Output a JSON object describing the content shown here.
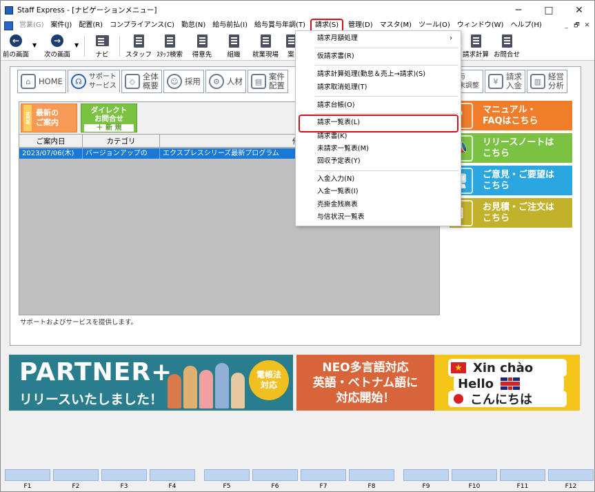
{
  "window": {
    "title": "Staff Express - [ナビゲーションメニュー]",
    "minimize": "─",
    "maximize": "□",
    "close": "✕"
  },
  "menubar": {
    "items": [
      {
        "label": "営業(G)",
        "disabled": true
      },
      {
        "label": "案件(J)"
      },
      {
        "label": "配置(R)"
      },
      {
        "label": "コンプライアンス(C)"
      },
      {
        "label": "勤怠(N)"
      },
      {
        "label": "給与前払(I)"
      },
      {
        "label": "給与賞与年調(T)"
      },
      {
        "label": "請求(S)",
        "active": true
      },
      {
        "label": "管理(D)"
      },
      {
        "label": "マスタ(M)"
      },
      {
        "label": "ツール(O)"
      },
      {
        "label": "ウィンドウ(W)"
      },
      {
        "label": "ヘルプ(H)"
      }
    ],
    "mdi": [
      "_",
      "🗗",
      "✕"
    ]
  },
  "toolbar": {
    "items": [
      {
        "name": "prev-screen-button",
        "label": "前の画面"
      },
      {
        "name": "next-screen-button",
        "label": "次の画面"
      },
      {
        "name": "navi-button",
        "label": "ナビ"
      },
      {
        "name": "staff-button",
        "label": "スタッフ"
      },
      {
        "name": "staff-search-button",
        "label": "ｽﾀｯﾌ検索"
      },
      {
        "name": "client-button",
        "label": "得意先"
      },
      {
        "name": "organization-button",
        "label": "組織"
      },
      {
        "name": "worksite-button",
        "label": "就業現場"
      },
      {
        "name": "case-button",
        "label": "案"
      },
      {
        "name": "billing-calc-button",
        "label": "請求計算"
      },
      {
        "name": "inquiry-button",
        "label": "お問合せ"
      }
    ]
  },
  "tabs": [
    {
      "label": "HOME"
    },
    {
      "label": "サポート\nサービス",
      "active": true
    },
    {
      "label": "全体\n概要"
    },
    {
      "label": "採用"
    },
    {
      "label": "人材"
    },
    {
      "label": "案件\n配置"
    },
    {
      "label": "給与\n年末調整"
    },
    {
      "label": "請求\n入金"
    },
    {
      "label": "経営\n分析"
    }
  ],
  "panel": {
    "news_button": {
      "tag": "NEW",
      "line1": "最新の",
      "line2": "ご案内"
    },
    "direct_button": {
      "line1": "ダイレクト",
      "line2": "お問合せ",
      "new": "＋ 新 規"
    },
    "columns": [
      "ご案内日",
      "カテゴリ",
      "件名"
    ],
    "rows": [
      [
        "2023/07/06(木)",
        "バージョンアップの",
        "エクスプレスシリーズ最新プログラム"
      ]
    ],
    "status": "サポートおよびサービスを提供します。"
  },
  "side_banners": [
    {
      "line1": "マニュアル・",
      "line2": "FAQはこちら",
      "color": "#ef7d2a",
      "icon": "?"
    },
    {
      "line1": "リリースノートは",
      "line2": "こちら",
      "color": "#7bc142",
      "icon": "📣"
    },
    {
      "line1": "ご意見・ご要望は",
      "line2": "こちら",
      "color": "#2aa7e0",
      "icon": "🖥"
    },
    {
      "line1": "お見積・ご注文は",
      "line2": "こちら",
      "color": "#c2b12a",
      "icon": "🖩"
    }
  ],
  "banner_partner": {
    "title": "PARTNER+",
    "subtitle": "リリースいたしました！",
    "badge_line1": "電帳法",
    "badge_line2": "対応"
  },
  "banner_neo": {
    "line1": "NEO多言語対応",
    "line2": "英語・ベトナム語に",
    "line3": "対応開始！",
    "xin": "Xin chào",
    "hello": "Hello",
    "konnichiwa": "こんにちは",
    "star": "★"
  },
  "fkeys": [
    "F1",
    "F2",
    "F3",
    "F4",
    "F5",
    "F6",
    "F7",
    "F8",
    "F9",
    "F10",
    "F11",
    "F12"
  ],
  "billing_menu": {
    "items": [
      {
        "label": "請求月額処理",
        "submenu": true,
        "arrow": "›"
      },
      {
        "label": "仮請求書(R)"
      },
      {
        "label": "請求計算処理(勤怠＆売上→請求)(S)"
      },
      {
        "label": "請求取消処理(T)"
      },
      {
        "label": "請求台帳(O)"
      },
      {
        "label": "請求一覧表(L)",
        "highlighted": true
      },
      {
        "label": "請求書(K)"
      },
      {
        "label": "未請求一覧表(M)"
      },
      {
        "label": "回収予定表(Y)"
      },
      {
        "label": "入金入力(N)"
      },
      {
        "label": "入金一覧表(I)"
      },
      {
        "label": "売掛金残高表"
      },
      {
        "label": "与信状況一覧表"
      }
    ]
  }
}
